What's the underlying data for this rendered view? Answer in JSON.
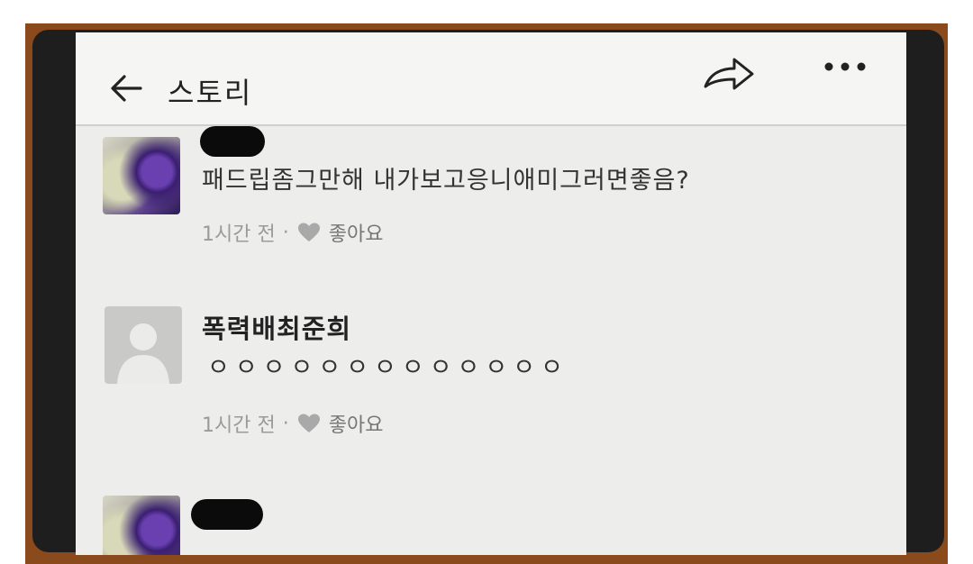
{
  "header": {
    "title": "스토리"
  },
  "comments": [
    {
      "author": "",
      "text": "패드립좀그만해 내가보고응니애미그러면좋음?",
      "time": "1시간 전",
      "separator": "·",
      "like_label": "좋아요"
    },
    {
      "author": "폭력배최준희",
      "text": "ㅇㅇㅇㅇㅇㅇㅇㅇㅇㅇㅇㅇㅇ",
      "time": "1시간 전",
      "separator": "·",
      "like_label": "좋아요"
    },
    {
      "author": "",
      "text": "",
      "time": "",
      "separator": "",
      "like_label": ""
    }
  ],
  "icons": {
    "back": "arrow-left-icon",
    "share": "share-arrow-icon",
    "more": "more-dots-icon",
    "like": "heart-icon"
  },
  "colors": {
    "frame": "#8a4a1c",
    "screen": "#ededec",
    "heart": "#a9a9a9"
  }
}
